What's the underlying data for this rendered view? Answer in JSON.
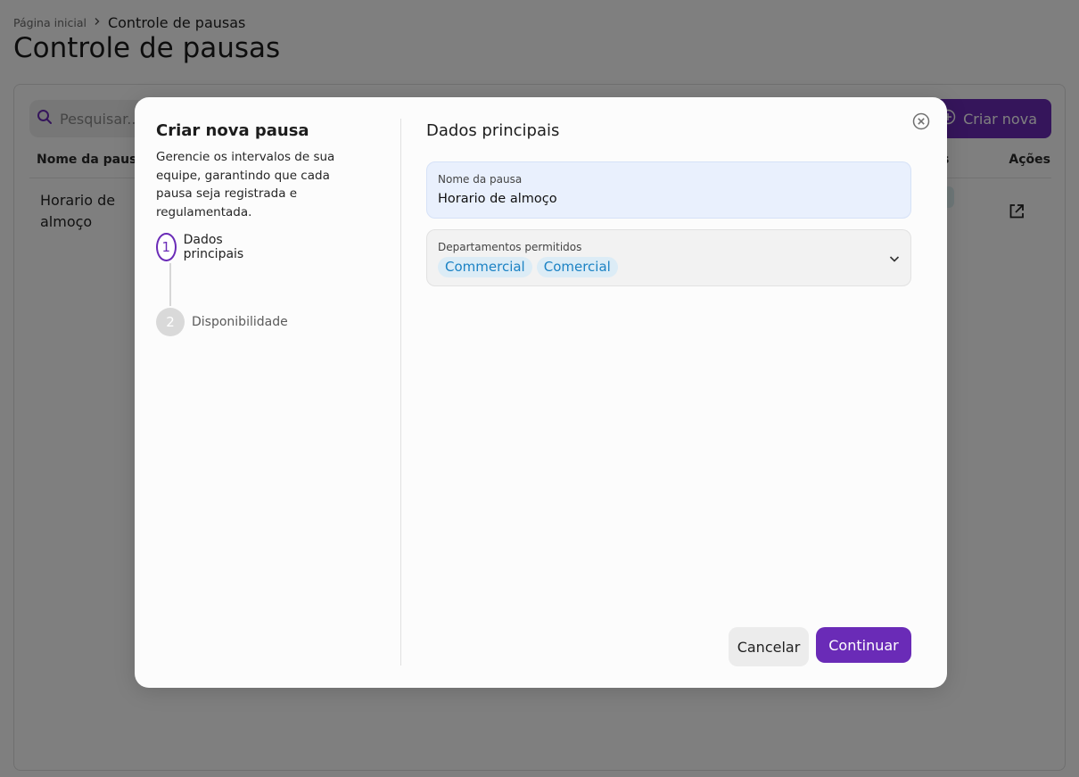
{
  "colors": {
    "primary": "#6a2bb7",
    "chip_text": "#1b82c4",
    "chip_bg": "#dcecf6",
    "field_active_bg": "#e9f0fd"
  },
  "breadcrumb": {
    "home": "Página inicial",
    "current": "Controle de pausas"
  },
  "page": {
    "title": "Controle de pausas",
    "search_placeholder": "Pesquisar...",
    "create_button": "Criar nova",
    "table": {
      "headers": {
        "name": "Nome da pausa",
        "status": "s",
        "actions": "Ações"
      },
      "rows": [
        {
          "name": "Horario de almoço"
        }
      ]
    }
  },
  "modal": {
    "title": "Criar nova pausa",
    "description": "Gerencie os intervalos de sua equipe, garantindo que cada pausa seja registrada e regulamentada.",
    "steps": [
      {
        "number": "1",
        "label": "Dados principais",
        "state": "active"
      },
      {
        "number": "2",
        "label": "Disponibilidade",
        "state": "pending"
      }
    ],
    "section_title": "Dados principais",
    "fields": {
      "name": {
        "label": "Nome da pausa",
        "value": "Horario de almoço"
      },
      "departments": {
        "label": "Departamentos permitidos",
        "chips": [
          "Commercial",
          "Comercial"
        ]
      }
    },
    "buttons": {
      "cancel": "Cancelar",
      "continue": "Continuar"
    }
  },
  "icons": {
    "search": "search-icon",
    "add": "plus-circle-icon",
    "external": "external-link-icon",
    "close": "close-circle-icon",
    "chevron": "chevron-down-icon"
  }
}
